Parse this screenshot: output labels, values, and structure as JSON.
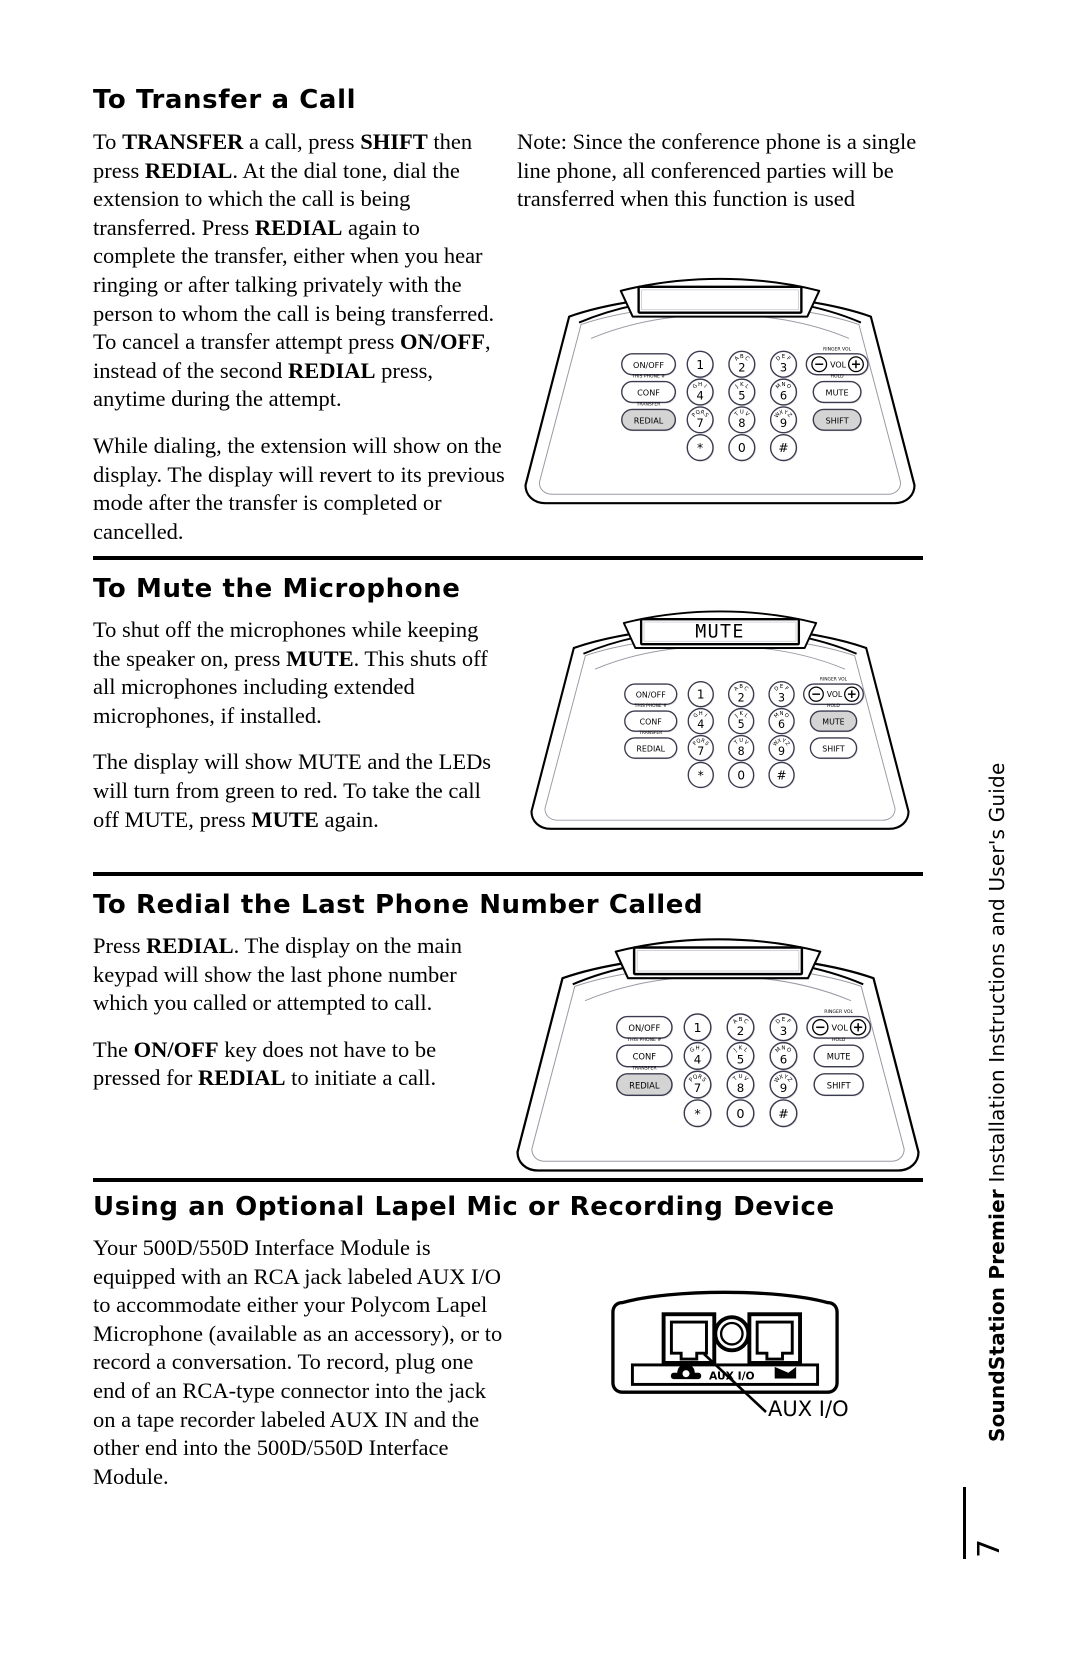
{
  "page": {
    "number": "7",
    "side_note_bold": "SoundStation Premier",
    "side_note_rest": " Installation Instructions and User's Guide"
  },
  "sections": [
    {
      "id": "transfer",
      "heading": "To Transfer a Call",
      "left_paragraphs": [
        {
          "runs": [
            {
              "t": "To ",
              "b": false
            },
            {
              "t": "TRANSFER",
              "b": true
            },
            {
              "t": " a call, press ",
              "b": false
            },
            {
              "t": "SHIFT",
              "b": true
            },
            {
              "t": " then press ",
              "b": false
            },
            {
              "t": "REDIAL",
              "b": true
            },
            {
              "t": ". At the dial tone, dial the extension to which the call is being transferred. Press ",
              "b": false
            },
            {
              "t": "REDIAL",
              "b": true
            },
            {
              "t": " again to complete the transfer, either when you hear ringing or after talking privately with the person to whom the call is being transferred. To cancel a transfer attempt press ",
              "b": false
            },
            {
              "t": "ON/OFF",
              "b": true
            },
            {
              "t": ", instead of the second ",
              "b": false
            },
            {
              "t": "REDIAL",
              "b": true
            },
            {
              "t": " press, anytime during the attempt.",
              "b": false
            }
          ]
        },
        {
          "runs": [
            {
              "t": "While dialing, the extension will show on the display. The display will revert to its previous mode after the transfer is completed or cancelled.",
              "b": false
            }
          ]
        }
      ],
      "right_paragraphs": [
        {
          "runs": [
            {
              "t": "Note: Since the conference phone is a single line phone, all conferenced parties will be transferred when this function is used",
              "b": false
            }
          ]
        }
      ],
      "diagram": {
        "type": "phone",
        "display_text": "",
        "highlighted_keys": [
          "REDIAL",
          "SHIFT"
        ]
      }
    },
    {
      "id": "mute",
      "heading": "To Mute the Microphone",
      "left_paragraphs": [
        {
          "runs": [
            {
              "t": "To shut off the microphones while keeping the speaker on, press ",
              "b": false
            },
            {
              "t": "MUTE",
              "b": true
            },
            {
              "t": ". This shuts off all microphones including extended microphones, if installed.",
              "b": false
            }
          ]
        },
        {
          "runs": [
            {
              "t": "The display will show MUTE and the LEDs will turn from green to red. To take the call off MUTE, press ",
              "b": false
            },
            {
              "t": "MUTE",
              "b": true
            },
            {
              "t": " again.",
              "b": false
            }
          ]
        }
      ],
      "right_paragraphs": [],
      "diagram": {
        "type": "phone",
        "display_text": "MUTE",
        "highlighted_keys": [
          "MUTE"
        ]
      }
    },
    {
      "id": "redial",
      "heading": "To Redial the Last Phone Number Called",
      "left_paragraphs": [
        {
          "runs": [
            {
              "t": "Press ",
              "b": false
            },
            {
              "t": "REDIAL",
              "b": true
            },
            {
              "t": ". The display on the main keypad will show the last phone number which you called or attempted to call.",
              "b": false
            }
          ]
        },
        {
          "runs": [
            {
              "t": "The ",
              "b": false
            },
            {
              "t": "ON/OFF",
              "b": true
            },
            {
              "t": " key does not have to be pressed for ",
              "b": false
            },
            {
              "t": "REDIAL",
              "b": true
            },
            {
              "t": " to initiate a call.",
              "b": false
            }
          ]
        }
      ],
      "right_paragraphs": [],
      "diagram": {
        "type": "phone",
        "display_text": "",
        "highlighted_keys": [
          "REDIAL"
        ]
      }
    },
    {
      "id": "lapel",
      "heading": "Using an Optional Lapel Mic or Recording Device",
      "left_paragraphs": [
        {
          "runs": [
            {
              "t": "Your 500D/550D Interface Module is equipped with an RCA jack labeled AUX I/O to accommodate either your Polycom Lapel Microphone (available as an accessory), or to record a conversation. To record, plug one end of an RCA-type connector into the jack on a tape recorder labeled AUX IN and the other end into the 500D/550D Interface Module.",
              "b": false
            }
          ]
        }
      ],
      "right_paragraphs": [],
      "diagram": {
        "type": "module",
        "jack_label": "AUX I/O",
        "left_icon": "telephone-icon",
        "right_icon": "mic-plug-icon",
        "callout": "AUX I/O"
      }
    }
  ],
  "phone_keypad": {
    "function_keys": [
      {
        "label": "ON/OFF",
        "above": "",
        "shape": "pill"
      },
      {
        "label": "CONF",
        "above": "THIS PHONE #",
        "shape": "pill"
      },
      {
        "label": "REDIAL",
        "above": "TRANSFER",
        "shape": "pill"
      }
    ],
    "right_keys": [
      {
        "label": "VOL",
        "above": "RINGER VOL",
        "shape": "vol"
      },
      {
        "label": "MUTE",
        "above": "HOLD",
        "shape": "pill"
      },
      {
        "label": "SHIFT",
        "above": "",
        "shape": "pill"
      }
    ],
    "number_keys": [
      {
        "digit": "1",
        "letters": ""
      },
      {
        "digit": "2",
        "letters": "ABC"
      },
      {
        "digit": "3",
        "letters": "DEF"
      },
      {
        "digit": "4",
        "letters": "GHI"
      },
      {
        "digit": "5",
        "letters": "JKL"
      },
      {
        "digit": "6",
        "letters": "MNO"
      },
      {
        "digit": "7",
        "letters": "PQRS"
      },
      {
        "digit": "8",
        "letters": "TUV"
      },
      {
        "digit": "9",
        "letters": "WXYZ"
      },
      {
        "digit": "*",
        "letters": ""
      },
      {
        "digit": "0",
        "letters": ""
      },
      {
        "digit": "#",
        "letters": ""
      }
    ],
    "vol_minus": "−",
    "vol_plus": "+"
  },
  "colors": {
    "ink": "#000000",
    "key_highlight": "#d4d4d4",
    "key_outline": "#3b3b4f",
    "shadow": "#e6e6e6"
  }
}
